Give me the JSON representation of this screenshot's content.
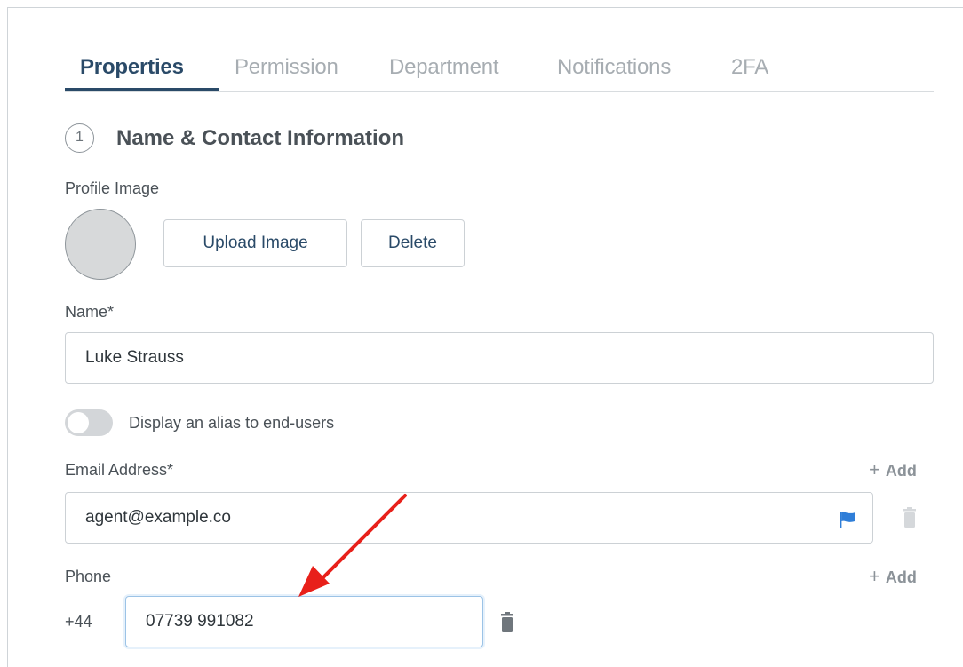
{
  "tabs": [
    {
      "label": "Properties",
      "active": true
    },
    {
      "label": "Permission",
      "active": false
    },
    {
      "label": "Department",
      "active": false
    },
    {
      "label": "Notifications",
      "active": false
    },
    {
      "label": "2FA",
      "active": false
    }
  ],
  "section": {
    "number": "1",
    "title": "Name & Contact Information"
  },
  "profile": {
    "label": "Profile Image",
    "upload_label": "Upload Image",
    "delete_label": "Delete"
  },
  "name": {
    "label": "Name*",
    "value": "Luke Strauss"
  },
  "alias": {
    "label": "Display an alias to end-users",
    "enabled": false
  },
  "email": {
    "label": "Email Address*",
    "add_label": "Add",
    "value": "agent@example.co",
    "flag_icon": "flag-icon",
    "trash_icon": "trash-icon"
  },
  "phone": {
    "label": "Phone",
    "add_label": "Add",
    "country_code": "+44",
    "value": "07739 991082",
    "trash_icon": "trash-icon"
  },
  "colors": {
    "accent": "#2a4a68",
    "flag": "#2f7ed8",
    "annotation_arrow": "#e8201a",
    "focus_border": "#9cc3e6"
  }
}
